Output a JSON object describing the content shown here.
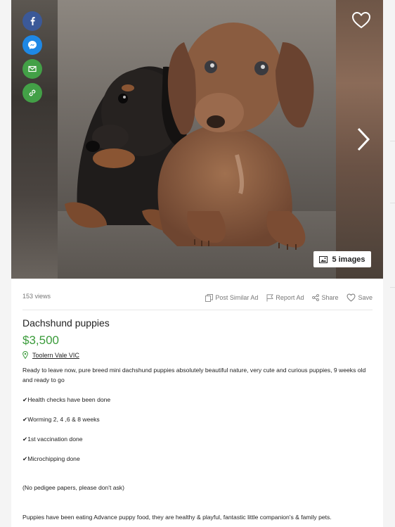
{
  "listing": {
    "views": "153 views",
    "title": "Dachshund puppies",
    "price": "$3,500",
    "location": "Toolern Vale VIC",
    "image_count": "5 images"
  },
  "actions": {
    "post_similar": "Post Similar Ad",
    "report": "Report Ad",
    "share": "Share",
    "save": "Save"
  },
  "share_icons": [
    "facebook-icon",
    "messenger-icon",
    "email-icon",
    "link-icon"
  ],
  "colors": {
    "price": "#3a9b3a",
    "facebook": "#3b5998",
    "messenger": "#1e88e5",
    "email": "#43a047",
    "link": "#43a047"
  },
  "description": {
    "intro": "Ready to leave now, pure breed mini dachshund puppies absolutely beautiful nature, very cute and curious puppies, 9 weeks old and ready to go",
    "health": "✔Health checks have been done",
    "worming": "✔Worming 2, 4 ,6 & 8 weeks",
    "vaccination": "✔1st vaccination done",
    "microchip": "✔Microchipping done",
    "pedigee": "(No pedigee papers, please don't ask)",
    "food": "Puppies have been eating Advance puppy food, they are healthy & playful, fantastic little companion's & family pets."
  }
}
